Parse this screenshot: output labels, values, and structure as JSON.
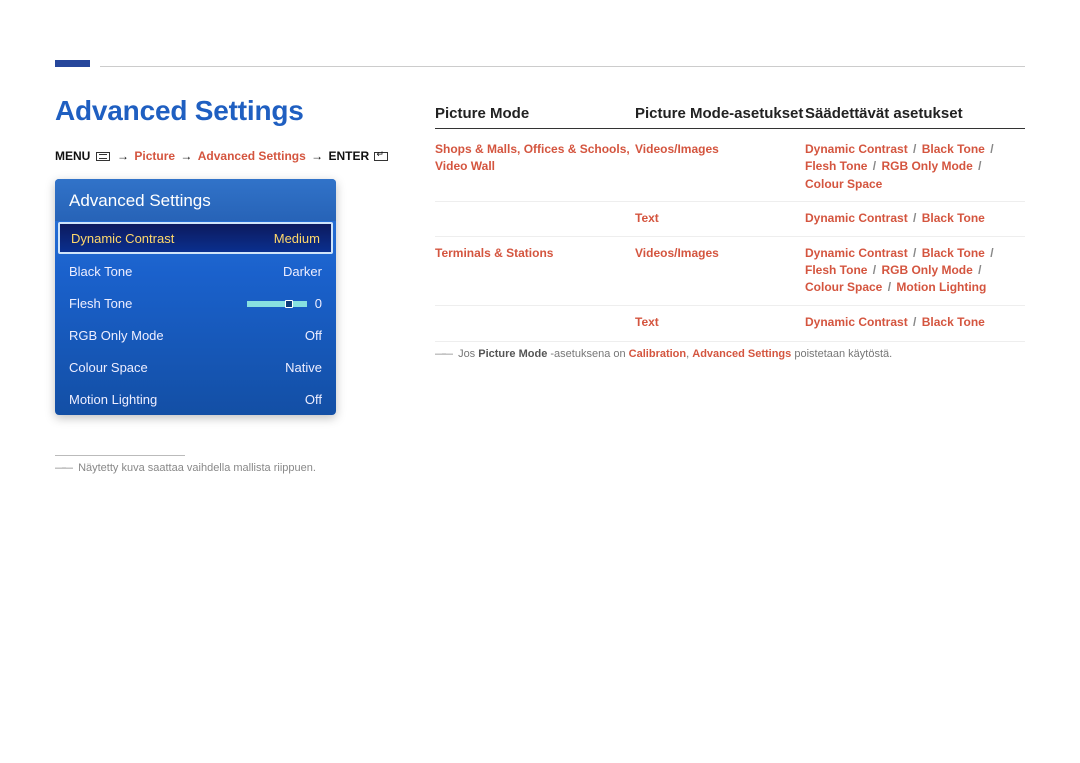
{
  "title": "Advanced Settings",
  "breadcrumb": {
    "menu": "MENU",
    "picture": "Picture",
    "advanced": "Advanced Settings",
    "enter": "ENTER"
  },
  "osd": {
    "title": "Advanced Settings",
    "rows": [
      {
        "label": "Dynamic Contrast",
        "value": "Medium",
        "selected": true
      },
      {
        "label": "Black Tone",
        "value": "Darker"
      },
      {
        "label": "Flesh Tone",
        "value": "0",
        "slider": true
      },
      {
        "label": "RGB Only Mode",
        "value": "Off"
      },
      {
        "label": "Colour Space",
        "value": "Native"
      },
      {
        "label": "Motion Lighting",
        "value": "Off"
      }
    ]
  },
  "footnote": {
    "text": "Näytetty kuva saattaa vaihdella mallista riippuen."
  },
  "table": {
    "headers": {
      "a": "Picture Mode",
      "b": "Picture Mode-asetukset",
      "c": "Säädettävät asetukset"
    },
    "rows": [
      {
        "a_parts": [
          "Shops & Malls",
          ", ",
          "Offices & Schools",
          ", ",
          "Video Wall"
        ],
        "b": "Videos/Images",
        "c_parts": [
          "Dynamic Contrast",
          " / ",
          "Black Tone",
          " / ",
          "Flesh Tone",
          " / ",
          "RGB Only Mode",
          " / ",
          "Colour Space"
        ]
      },
      {
        "a_parts": [],
        "b": "Text",
        "c_parts": [
          "Dynamic Contrast",
          " / ",
          "Black Tone"
        ]
      },
      {
        "a_parts": [
          "Terminals & Stations"
        ],
        "b": "Videos/Images",
        "c_parts": [
          "Dynamic Contrast",
          " / ",
          "Black Tone",
          " / ",
          "Flesh Tone",
          " / ",
          "RGB Only Mode",
          " / ",
          "Colour Space",
          " / ",
          "Motion Lighting"
        ]
      },
      {
        "a_parts": [],
        "b": "Text",
        "c_parts": [
          "Dynamic Contrast",
          " / ",
          "Black Tone"
        ]
      }
    ],
    "note": {
      "pre": "Jos ",
      "s1": "Picture Mode",
      "mid1": " -asetuksena on ",
      "s2": "Calibration",
      "mid2": ", ",
      "s3": "Advanced Settings",
      "post": " poistetaan käytöstä."
    }
  }
}
